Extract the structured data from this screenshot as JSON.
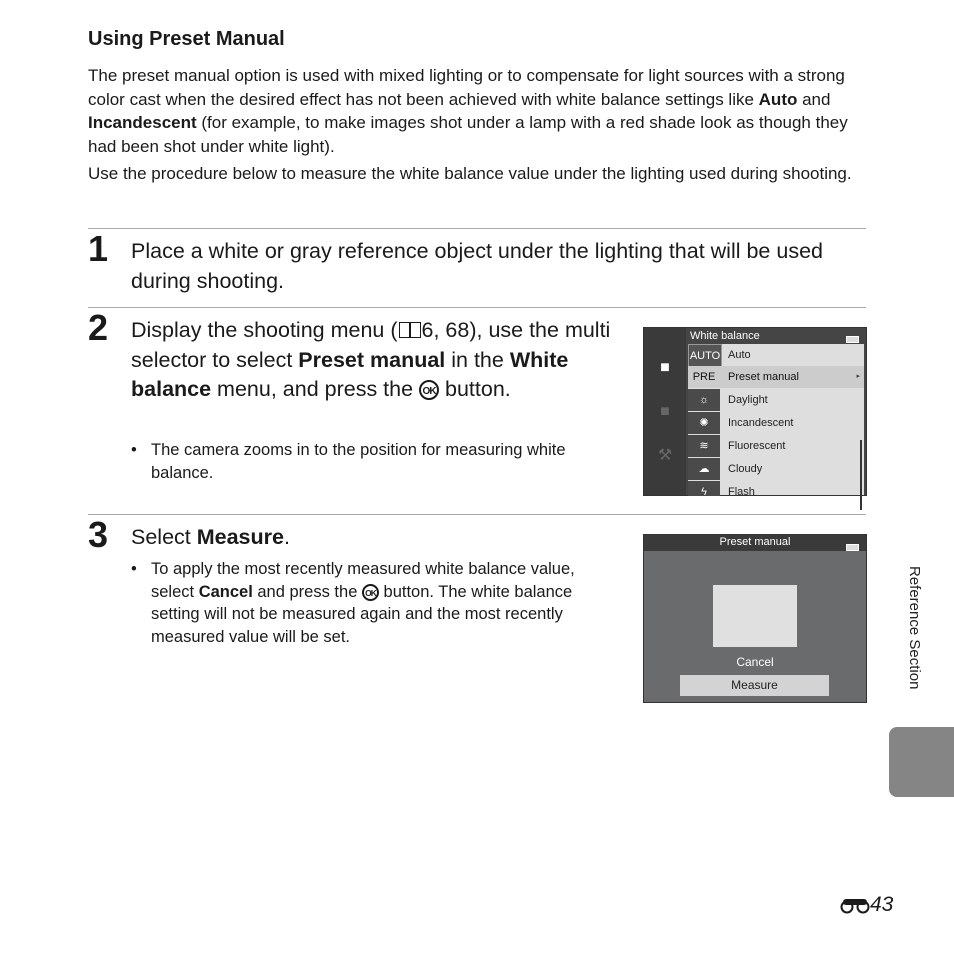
{
  "section": {
    "title": "Using Preset Manual",
    "intro": [
      {
        "t": "The preset manual option is used with mixed lighting or to compensate for light sources with a strong color cast when the desired effect has not been achieved with white balance settings like ",
        "b": false
      },
      {
        "t": "Auto",
        "b": true
      },
      {
        "t": " and ",
        "b": false
      },
      {
        "t": "Incandescent",
        "b": true
      },
      {
        "t": " (for example, to make images shot under a lamp with a red shade look as though they had been shot under white light).",
        "b": false
      }
    ],
    "intro2": "Use the procedure below to measure the white balance value under the lighting used during shooting."
  },
  "steps": [
    {
      "num": "1",
      "text": "Place a white or gray reference object under the lighting that will be used during shooting."
    },
    {
      "num": "2",
      "text_a": "Display the shooting menu (",
      "ref": "6, 68), use the multi selector to select ",
      "bold1": "Preset manual",
      "text_b": " in the ",
      "bold2": "White balance",
      "text_c": " menu, and press the ",
      "text_d": " button.",
      "bullet": "The camera zooms in to the position for measuring white balance."
    },
    {
      "num": "3",
      "text_a": "Select ",
      "bold1": "Measure",
      "text_b": ".",
      "bullet_a": "To apply the most recently measured white balance value, select ",
      "bullet_bold": "Cancel",
      "bullet_b": " and press the ",
      "bullet_c": " button. The white balance setting will not be measured again and the most recently measured value will be set."
    }
  ],
  "ok_glyph": "OK",
  "bullet_glyph": "•",
  "screen1": {
    "header": "White balance",
    "side_icons": [
      "camera-icon",
      "movie-camera-icon",
      "wrench-icon"
    ],
    "items": [
      {
        "icon": "AUTO",
        "label": "Auto"
      },
      {
        "icon": "PRE",
        "label": "Preset manual",
        "selected": true
      },
      {
        "icon": "☼",
        "label": "Daylight"
      },
      {
        "icon": "✺",
        "label": "Incandescent"
      },
      {
        "icon": "≋",
        "label": "Fluorescent"
      },
      {
        "icon": "☁",
        "label": "Cloudy"
      },
      {
        "icon": "ϟ",
        "label": "Flash"
      }
    ],
    "arrow": "▸"
  },
  "screen2": {
    "header": "Preset manual",
    "cancel": "Cancel",
    "measure": "Measure"
  },
  "side_tab": {
    "label": "Reference Section"
  },
  "page": {
    "number": "43"
  }
}
